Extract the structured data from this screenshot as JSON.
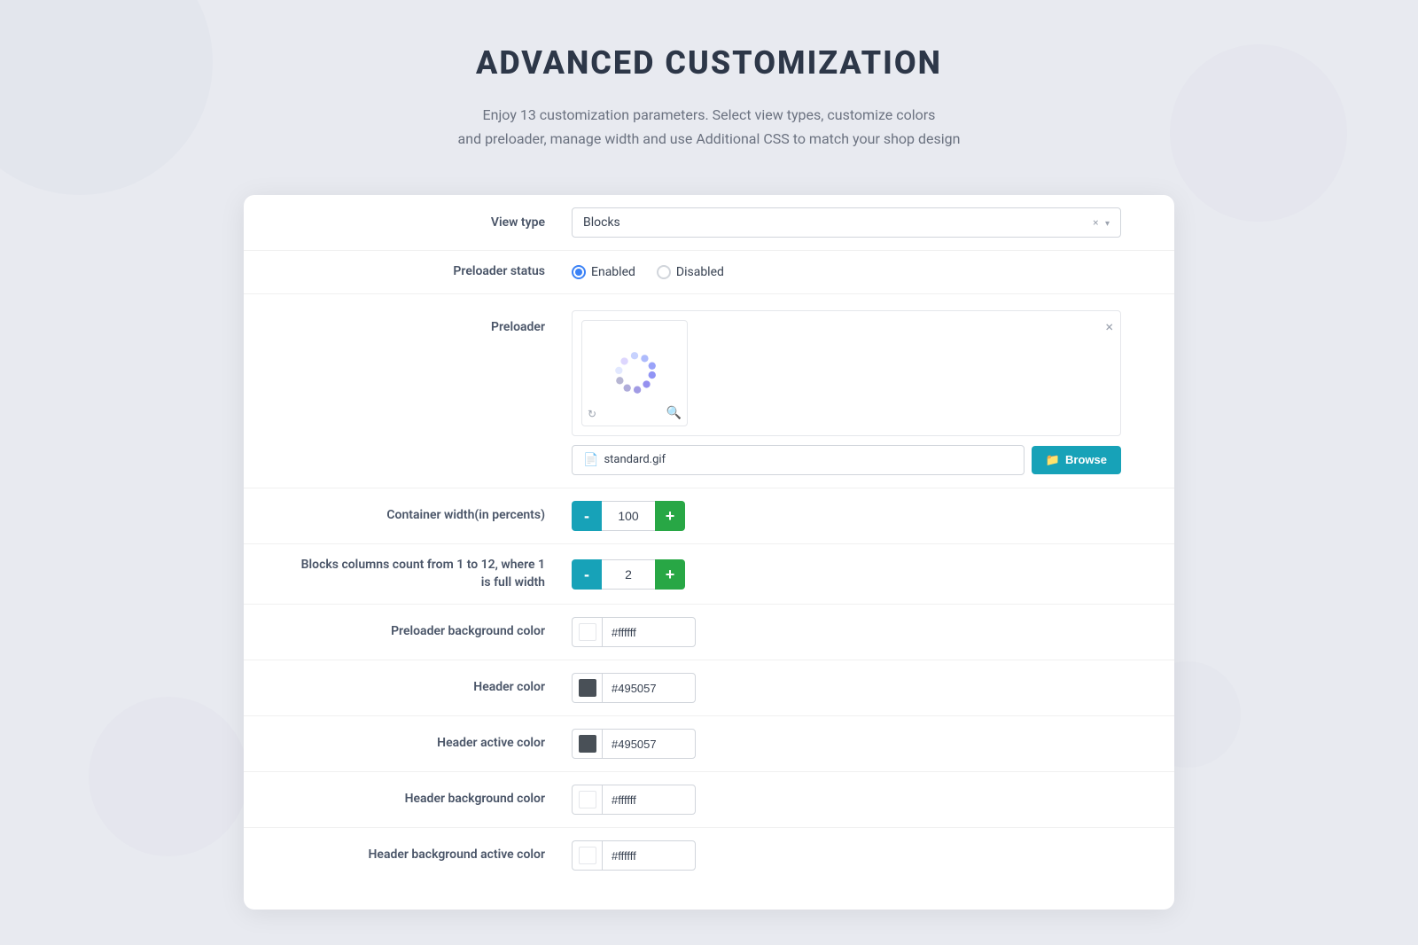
{
  "page": {
    "title": "ADVANCED CUSTOMIZATION",
    "subtitle_line1": "Enjoy 13 customization parameters. Select view types, customize colors",
    "subtitle_line2": "and preloader, manage width and use Additional CSS to match your shop design"
  },
  "form": {
    "view_type": {
      "label": "View type",
      "value": "Blocks"
    },
    "preloader_status": {
      "label": "Preloader status",
      "enabled_label": "Enabled",
      "disabled_label": "Disabled"
    },
    "preloader": {
      "label": "Preloader",
      "filename": "standard.gif",
      "browse_label": "Browse"
    },
    "container_width": {
      "label": "Container width(in percents)",
      "value": "100"
    },
    "blocks_columns": {
      "label": "Blocks columns count from 1 to 12, where 1 is full width",
      "value": "2"
    },
    "preloader_bg_color": {
      "label": "Preloader background color",
      "value": "#ffffff",
      "swatch": "#ffffff"
    },
    "header_color": {
      "label": "Header color",
      "value": "#495057",
      "swatch": "#495057"
    },
    "header_active_color": {
      "label": "Header active color",
      "value": "#495057",
      "swatch": "#495057"
    },
    "header_bg_color": {
      "label": "Header background color",
      "value": "#ffffff",
      "swatch": "#ffffff"
    },
    "header_bg_active_color": {
      "label": "Header background active color",
      "value": "#ffffff",
      "swatch": "#ffffff"
    }
  },
  "colors": {
    "browse_btn": "#17a2b8",
    "minus_btn": "#17a2b8",
    "plus_btn": "#28a745",
    "radio_active": "#3b82f6"
  }
}
